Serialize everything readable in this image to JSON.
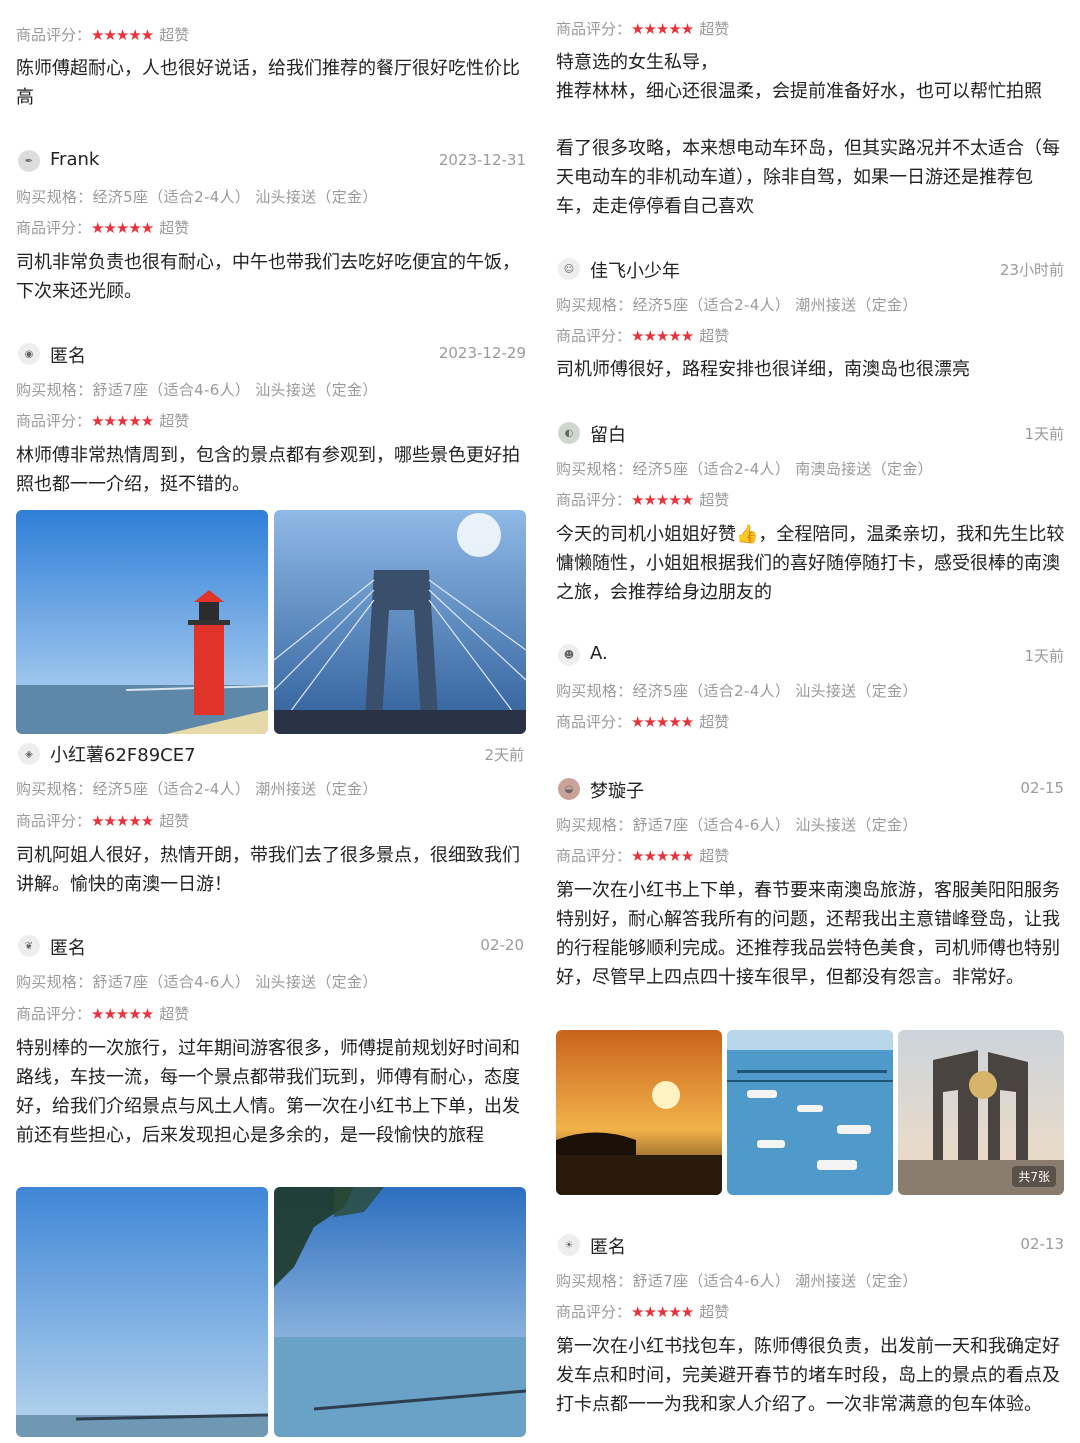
{
  "labels": {
    "spec_prefix": "购买规格：",
    "rating_prefix": "商品评分：",
    "stars": "★★★★★",
    "rating_word": "超赞"
  },
  "left": {
    "r0": {
      "body": "陈师傅超耐心，人也很好说话，给我们推荐的餐厅很好吃性价比高"
    },
    "r1": {
      "user": "Frank",
      "date": "2023-12-31",
      "spec": "经济5座（适合2-4人）  汕头接送（定金）",
      "body": "司机非常负责也很有耐心，中午也带我们去吃好吃便宜的午饭，下次来还光顾。"
    },
    "r2": {
      "user": "匿名",
      "date": "2023-12-29",
      "spec": "舒适7座（适合4-6人）  汕头接送（定金）",
      "body": "林师傅非常热情周到，包含的景点都有参观到，哪些景色更好拍照也都一一介绍，挺不错的。"
    },
    "r3": {
      "user": "小红薯62F89CE7",
      "date": "2天前",
      "spec": "经济5座（适合2-4人）  潮州接送（定金）",
      "body": "司机阿姐人很好，热情开朗，带我们去了很多景点，很细致我们讲解。愉快的南澳一日游！"
    },
    "r4": {
      "user": "匿名",
      "date": "02-20",
      "spec": "舒适7座（适合4-6人）  汕头接送（定金）",
      "body": "特别棒的一次旅行，过年期间游客很多，师傅提前规划好时间和路线，车技一流，每一个景点都带我们玩到，师傅有耐心，态度好，给我们介绍景点与风土人情。第一次在小红书上下单，出发前还有些担心，后来发现担心是多余的，是一段愉快的旅程"
    }
  },
  "right": {
    "r0": {
      "body1": "特意选的女生私导，",
      "body2": "推荐林林，细心还很温柔，会提前准备好水，也可以帮忙拍照",
      "body3": "看了很多攻略，本来想电动车环岛，但其实路况并不太适合（每天电动车的非机动车道），除非自驾，如果一日游还是推荐包车，走走停停看自己喜欢"
    },
    "r1": {
      "user": "佳飞小少年",
      "date": "23小时前",
      "spec": "经济5座（适合2-4人）  潮州接送（定金）",
      "body": "司机师傅很好，路程安排也很详细，南澳岛也很漂亮"
    },
    "r2": {
      "user": "留白",
      "date": "1天前",
      "spec": "经济5座（适合2-4人）  南澳岛接送（定金）",
      "body": "今天的司机小姐姐好赞👍，全程陪同，温柔亲切，我和先生比较慵懒随性，小姐姐根据我们的喜好随停随打卡，感受很棒的南澳之旅，会推荐给身边朋友的"
    },
    "r3": {
      "user": "A.",
      "date": "1天前",
      "spec": "经济5座（适合2-4人）  汕头接送（定金）"
    },
    "r4": {
      "user": "梦璇子",
      "date": "02-15",
      "spec": "舒适7座（适合4-6人）  汕头接送（定金）",
      "body": "第一次在小红书上下单，春节要来南澳岛旅游，客服美阳阳服务特别好，耐心解答我所有的问题，还帮我出主意错峰登岛，让我的行程能够顺利完成。还推荐我品尝特色美食，司机师傅也特别好，尽管早上四点四十接车很早，但都没有怨言。非常好。",
      "photo_count": "共7张"
    },
    "r5": {
      "user": "匿名",
      "date": "02-13",
      "spec": "舒适7座（适合4-6人）  潮州接送（定金）",
      "body": "第一次在小红书找包车，陈师傅很负责，出发前一天和我确定好发车点和时间，完美避开春节的堵车时段，岛上的景点的看点及打卡点都一一为我和家人介绍了。一次非常满意的包车体验。"
    }
  }
}
